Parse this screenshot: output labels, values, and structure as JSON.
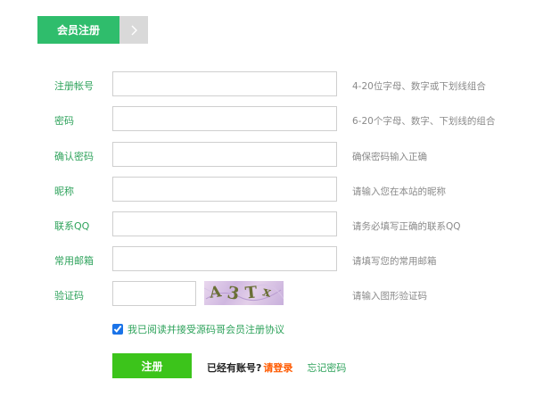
{
  "tabs": {
    "active_label": "会员注册",
    "next_icon": "chevron-right-icon"
  },
  "form": {
    "fields": [
      {
        "label": "注册帐号",
        "value": "",
        "hint": "4-20位字母、数字或下划线组合"
      },
      {
        "label": "密码",
        "value": "",
        "hint": "6-20个字母、数字、下划线的组合"
      },
      {
        "label": "确认密码",
        "value": "",
        "hint": "确保密码输入正确"
      },
      {
        "label": "昵称",
        "value": "",
        "hint": "请输入您在本站的昵称"
      },
      {
        "label": "联系QQ",
        "value": "",
        "hint": "请务必填写正确的联系QQ"
      },
      {
        "label": "常用邮箱",
        "value": "",
        "hint": "请填写您的常用邮箱"
      }
    ],
    "captcha": {
      "label": "验证码",
      "value": "",
      "text": "A3Tx",
      "hint": "请输入图形验证码"
    },
    "agreement": {
      "checked": true,
      "text": "我已阅读并接受源码哥会员注册协议"
    },
    "submit_label": "注册",
    "have_account_text": "已经有账号?",
    "login_link": "请登录",
    "forgot_link": "忘记密码"
  },
  "colors": {
    "accent": "#2fbd6c",
    "label": "#2fa35c",
    "button": "#3cc41b",
    "login_link": "#ff5a00"
  }
}
